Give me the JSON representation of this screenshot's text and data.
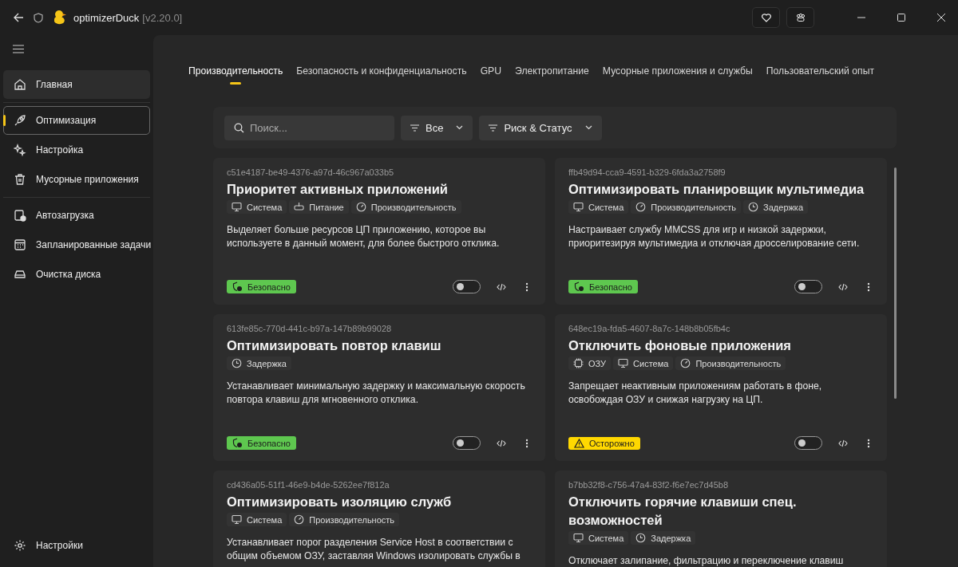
{
  "window": {
    "title": "optimizerDuck",
    "version": "[v2.20.0]"
  },
  "sidebar": {
    "groups": [
      [
        {
          "label": "Главная",
          "selected": false,
          "highlighted": true
        }
      ],
      [
        {
          "label": "Оптимизация",
          "selected": true,
          "highlighted": false
        },
        {
          "label": "Настройка",
          "selected": false,
          "highlighted": false
        },
        {
          "label": "Мусорные приложения",
          "selected": false,
          "highlighted": false
        }
      ],
      [
        {
          "label": "Автозагрузка",
          "selected": false,
          "highlighted": false
        },
        {
          "label": "Запланированные задачи",
          "selected": false,
          "highlighted": false
        },
        {
          "label": "Очистка диска",
          "selected": false,
          "highlighted": false
        }
      ]
    ],
    "footer": {
      "label": "Настройки"
    }
  },
  "tabs": [
    {
      "label": "Производительность",
      "selected": true
    },
    {
      "label": "Безопасность и конфиденциальность",
      "selected": false
    },
    {
      "label": "GPU",
      "selected": false
    },
    {
      "label": "Электропитание",
      "selected": false
    },
    {
      "label": "Мусорные приложения и службы",
      "selected": false
    },
    {
      "label": "Пользовательский опыт",
      "selected": false
    }
  ],
  "filters": {
    "search": {
      "placeholder": "Поиск..."
    },
    "category": "Все",
    "sort": "Риск & Статус"
  },
  "cards": [
    {
      "id": "c51e4187-be49-4376-a97d-46c967a033b5",
      "title": "Приоритет активных приложений",
      "tags": [
        {
          "kind": "system",
          "label": "Система"
        },
        {
          "kind": "power",
          "label": "Питание"
        },
        {
          "kind": "performance",
          "label": "Производительность"
        }
      ],
      "description": "Выделяет больше ресурсов ЦП приложению, которое вы используете в данный момент, для более быстрого отклика.",
      "risk": {
        "kind": "safe",
        "label": "Безопасно"
      },
      "on": false
    },
    {
      "id": "ffb49d94-cca9-4591-b329-6fda3a2758f9",
      "title": "Оптимизировать планировщик мультимедиа",
      "tags": [
        {
          "kind": "system",
          "label": "Система"
        },
        {
          "kind": "performance",
          "label": "Производительность"
        },
        {
          "kind": "latency",
          "label": "Задержка"
        }
      ],
      "description": "Настраивает службу MMCSS для игр и низкой задержки, приоритезируя мультимедиа и отключая дросселирование сети.",
      "risk": {
        "kind": "safe",
        "label": "Безопасно"
      },
      "on": false
    },
    {
      "id": "613fe85c-770d-441c-b97a-147b89b99028",
      "title": "Оптимизировать повтор клавиш",
      "tags": [
        {
          "kind": "latency",
          "label": "Задержка"
        }
      ],
      "description": "Устанавливает минимальную задержку и максимальную скорость повтора клавиш для мгновенного отклика.",
      "risk": {
        "kind": "safe",
        "label": "Безопасно"
      },
      "on": false
    },
    {
      "id": "648ec19a-fda5-4607-8a7c-148b8b05fb4c",
      "title": "Отключить фоновые приложения",
      "tags": [
        {
          "kind": "ram",
          "label": "ОЗУ"
        },
        {
          "kind": "system",
          "label": "Система"
        },
        {
          "kind": "performance",
          "label": "Производительность"
        }
      ],
      "description": "Запрещает неактивным приложениям работать в фоне, освобождая ОЗУ и снижая нагрузку на ЦП.",
      "risk": {
        "kind": "caution",
        "label": "Осторожно"
      },
      "on": false
    },
    {
      "id": "cd436a05-51f1-46e9-b4de-5262ee7f812a",
      "title": "Оптимизировать изоляцию служб",
      "tags": [
        {
          "kind": "system",
          "label": "Система"
        },
        {
          "kind": "performance",
          "label": "Производительность"
        }
      ],
      "description": "Устанавливает порог разделения Service Host в соответствии с общим объемом ОЗУ, заставляя Windows изолировать службы в"
    },
    {
      "id": "b7bb32f8-c756-47a4-83f2-f6e7ec7d45b8",
      "title": "Отключить горячие клавиши спец. возможностей",
      "tags": [
        {
          "kind": "system",
          "label": "Система"
        },
        {
          "kind": "latency",
          "label": "Задержка"
        }
      ],
      "description": "Отключает залипание, фильтрацию и переключение клавиш"
    }
  ]
}
